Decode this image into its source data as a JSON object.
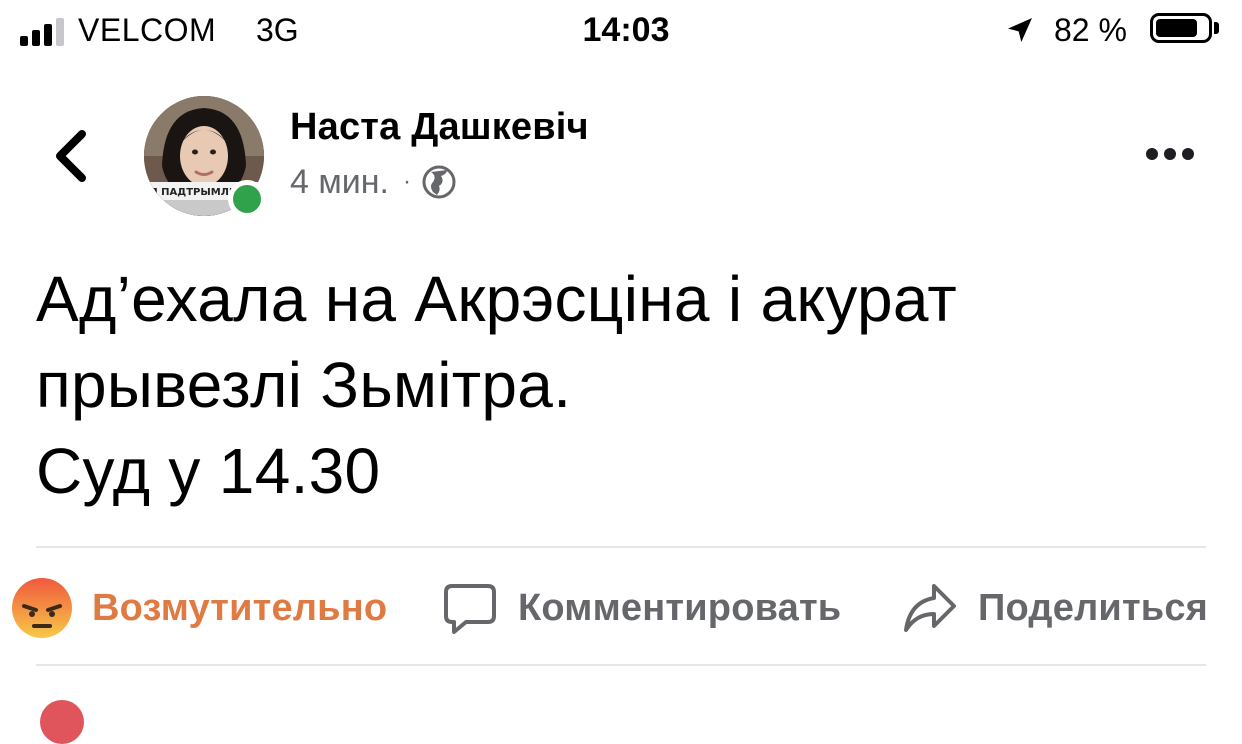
{
  "status_bar": {
    "carrier": "VELCOM",
    "network": "3G",
    "time": "14:03",
    "battery_percent": "82 %",
    "battery_level": 0.82,
    "signal_bars": 3
  },
  "post": {
    "author": "Наста Дашкевіч",
    "timestamp": "4 мин.",
    "separator": "·",
    "avatar_banner": "Я ПАДТРЫМЛІВ",
    "online": true,
    "text": "Ад’ехала на Акрэсціна і акурат\nпрывезлі Зьмітра.\nСуд у 14.30"
  },
  "actions": {
    "reaction_label": "Возмутительно",
    "comment_label": "Комментировать",
    "share_label": "Поделиться"
  },
  "colors": {
    "reaction": "#e07a43",
    "secondary_text": "#65676b",
    "online": "#31a24c",
    "divider": "#e4e6eb"
  },
  "icons": [
    "signal-icon",
    "location-arrow-icon",
    "battery-icon",
    "back-chevron-icon",
    "globe-icon",
    "more-dots-icon",
    "angry-face-icon",
    "comment-icon",
    "share-icon"
  ]
}
